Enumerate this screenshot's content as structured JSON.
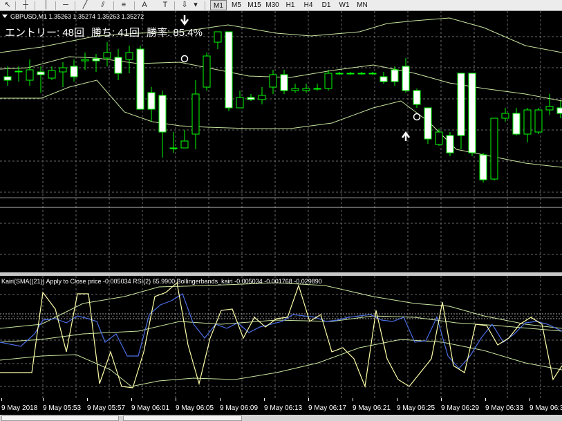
{
  "symbol_info": "GBPUSD,M1  1.35263 1.35274 1.35263 1.35272",
  "stats": {
    "entries": "エントリー: 48回",
    "wins": "勝ち: 41回",
    "rate": "勝率: 85.4%"
  },
  "timeframes": [
    "M1",
    "M5",
    "M15",
    "M30",
    "H1",
    "H4",
    "D1",
    "W1",
    "MN"
  ],
  "toolbar_tools": [
    {
      "name": "cursor-icon",
      "glyph": "↖"
    },
    {
      "name": "crosshair-icon",
      "glyph": "┼"
    },
    {
      "name": "vertical-line-icon",
      "glyph": "│"
    },
    {
      "name": "horizontal-line-icon",
      "glyph": "─"
    },
    {
      "name": "trendline-icon",
      "glyph": "╱"
    },
    {
      "name": "channel-icon",
      "glyph": "⫽"
    },
    {
      "name": "fibonacci-icon",
      "glyph": "≡"
    },
    {
      "name": "text-icon",
      "glyph": "A"
    },
    {
      "name": "text-label-icon",
      "glyph": "T"
    },
    {
      "name": "arrow-tool-icon",
      "glyph": "⇩"
    }
  ],
  "indicator_label": "Kairi(SMA((21)) Apply to Close price -0.005034  RSI(2) 65.9900  Bollingerbands_kairi -0.005034 -0.001768 -0.029890",
  "x_labels": [
    "9 May 2018",
    "9 May 05:53",
    "9 May 05:57",
    "9 May 06:01",
    "9 May 06:05",
    "9 May 06:09",
    "9 May 06:13",
    "9 May 06:17",
    "9 May 06:21",
    "9 May 06:25",
    "9 May 06:29",
    "9 May 06:33",
    "9 May 06:3"
  ],
  "colors": {
    "candle_bull": "#000000",
    "candle_bear": "#ffffff",
    "candle_outline": "#00ff00",
    "bands": "#c8e6a0",
    "kairi": "#4a6fe8",
    "rsi": "#ffffaa",
    "grid": "#6a6a6a"
  },
  "signals": [
    {
      "type": "sell-arrow",
      "candle": 16
    },
    {
      "type": "buy-arrow",
      "candle": 36
    }
  ],
  "candles": [
    {
      "o": 95,
      "c": 100,
      "h": 80,
      "l": 108
    },
    {
      "o": 87,
      "c": 87,
      "h": 80,
      "l": 102
    },
    {
      "o": 100,
      "c": 85,
      "h": 70,
      "l": 108
    },
    {
      "o": 88,
      "c": 92,
      "h": 80,
      "l": 118
    },
    {
      "o": 97,
      "c": 86,
      "h": 80,
      "l": 100
    },
    {
      "o": 88,
      "c": 82,
      "h": 74,
      "l": 110
    },
    {
      "o": 80,
      "c": 95,
      "h": 70,
      "l": 102
    },
    {
      "o": 72,
      "c": 70,
      "h": 60,
      "l": 85
    },
    {
      "o": 69,
      "c": 72,
      "h": 62,
      "l": 88
    },
    {
      "o": 68,
      "c": 60,
      "h": 45,
      "l": 80
    },
    {
      "o": 67,
      "c": 90,
      "h": 55,
      "l": 100
    },
    {
      "o": 70,
      "c": 60,
      "h": 50,
      "l": 90
    },
    {
      "o": 55,
      "c": 142,
      "h": 50,
      "l": 142
    },
    {
      "o": 118,
      "c": 142,
      "h": 110,
      "l": 160
    },
    {
      "o": 122,
      "c": 175,
      "h": 115,
      "l": 212
    },
    {
      "o": 198,
      "c": 198,
      "h": 175,
      "l": 205
    },
    {
      "o": 198,
      "c": 188,
      "h": 172,
      "l": 195
    },
    {
      "o": 178,
      "c": 120,
      "h": 100,
      "l": 200
    },
    {
      "o": 110,
      "c": 65,
      "h": 60,
      "l": 115
    },
    {
      "o": 45,
      "c": 30,
      "h": 30,
      "l": 55
    },
    {
      "o": 30,
      "c": 140,
      "h": 30,
      "l": 145
    },
    {
      "o": 140,
      "c": 125,
      "h": 115,
      "l": 140
    },
    {
      "o": 125,
      "c": 128,
      "h": 120,
      "l": 130
    },
    {
      "o": 128,
      "c": 122,
      "h": 110,
      "l": 135
    },
    {
      "o": 110,
      "c": 92,
      "h": 85,
      "l": 120
    },
    {
      "o": 92,
      "c": 115,
      "h": 85,
      "l": 120
    },
    {
      "o": 115,
      "c": 112,
      "h": 105,
      "l": 118
    },
    {
      "o": 115,
      "c": 112,
      "h": 105,
      "l": 118
    },
    {
      "o": 112,
      "c": 112,
      "h": 105,
      "l": 115
    },
    {
      "o": 112,
      "c": 90,
      "h": 85,
      "l": 115
    },
    {
      "o": 90,
      "c": 90,
      "h": 88,
      "l": 92
    },
    {
      "o": 90,
      "c": 90,
      "h": 88,
      "l": 92
    },
    {
      "o": 90,
      "c": 90,
      "h": 88,
      "l": 92
    },
    {
      "o": 90,
      "c": 90,
      "h": 88,
      "l": 92
    },
    {
      "o": 95,
      "c": 102,
      "h": 88,
      "l": 105
    },
    {
      "o": 85,
      "c": 102,
      "h": 80,
      "l": 108
    },
    {
      "o": 80,
      "c": 115,
      "h": 68,
      "l": 118
    },
    {
      "o": 115,
      "c": 135,
      "h": 112,
      "l": 140
    },
    {
      "o": 140,
      "c": 185,
      "h": 140,
      "l": 192
    },
    {
      "o": 193,
      "c": 175,
      "h": 170,
      "l": 195
    },
    {
      "o": 180,
      "c": 205,
      "h": 175,
      "l": 210
    },
    {
      "o": 90,
      "c": 180,
      "h": 90,
      "l": 200
    },
    {
      "o": 90,
      "c": 205,
      "h": 90,
      "l": 210
    },
    {
      "o": 208,
      "c": 244,
      "h": 205,
      "l": 248
    },
    {
      "o": 243,
      "c": 155,
      "h": 155,
      "l": 245
    },
    {
      "o": 155,
      "c": 148,
      "h": 140,
      "l": 160
    },
    {
      "o": 148,
      "c": 178,
      "h": 140,
      "l": 180
    },
    {
      "o": 178,
      "c": 143,
      "h": 140,
      "l": 190
    },
    {
      "o": 175,
      "c": 143,
      "h": 140,
      "l": 178
    },
    {
      "o": 143,
      "c": 138,
      "h": 120,
      "l": 150
    },
    {
      "o": 140,
      "c": 148,
      "h": 130,
      "l": 155
    },
    {
      "o": 153,
      "c": 200,
      "h": 150,
      "l": 205
    }
  ]
}
